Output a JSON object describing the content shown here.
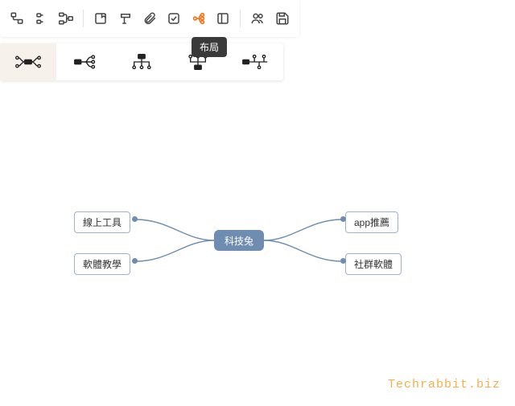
{
  "toolbar": {
    "tooltip_layout": "布局"
  },
  "mindmap": {
    "center": "科技兔",
    "nodes": {
      "top_left": "線上工具",
      "bottom_left": "軟體教學",
      "top_right": "app推薦",
      "bottom_right": "社群軟體"
    }
  },
  "watermark": "Techrabbit.biz",
  "icons": {
    "add_child": "add-child-icon",
    "add_sibling": "add-sibling-icon",
    "add_parent": "add-parent-icon",
    "card": "card-icon",
    "format": "format-icon",
    "attach": "attach-icon",
    "checkbox": "checkbox-icon",
    "layout": "layout-icon",
    "panel": "panel-icon",
    "collaborate": "collaborate-icon",
    "save": "save-icon"
  },
  "layout_options": [
    "both-sides",
    "right-tree",
    "org-down",
    "org-up",
    "timeline"
  ]
}
